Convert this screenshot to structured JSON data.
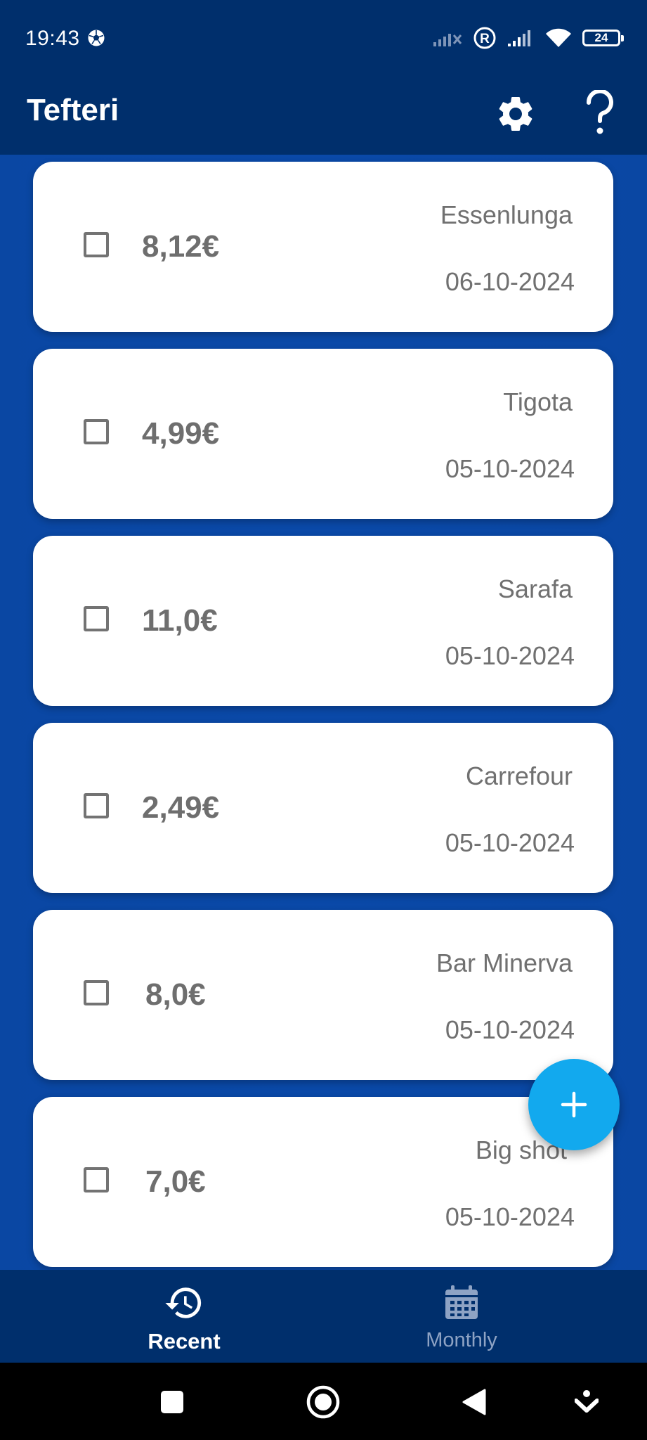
{
  "status_bar": {
    "time": "19:43",
    "battery_level": "24",
    "icons": [
      "soccer-ball-icon",
      "no-signal-icon",
      "roaming-icon",
      "signal-icon",
      "wifi-icon",
      "battery-icon"
    ]
  },
  "app_bar": {
    "title": "Tefteri",
    "actions": [
      "gear-icon",
      "help-icon"
    ]
  },
  "expenses": [
    {
      "amount": "8,12€",
      "merchant": "Essenlunga",
      "date": "06-10-2024",
      "checked": false
    },
    {
      "amount": "4,99€",
      "merchant": "Tigota",
      "date": "05-10-2024",
      "checked": false
    },
    {
      "amount": "11,0€",
      "merchant": "Sarafa",
      "date": "05-10-2024",
      "checked": false
    },
    {
      "amount": "2,49€",
      "merchant": "Carrefour",
      "date": "05-10-2024",
      "checked": false
    },
    {
      "amount": "8,0€",
      "merchant": "Bar Minerva",
      "date": "05-10-2024",
      "checked": false
    },
    {
      "amount": "7,0€",
      "merchant": "Big shot",
      "date": "05-10-2024",
      "checked": false
    }
  ],
  "fab": {
    "icon": "plus-icon"
  },
  "bottom_nav": {
    "items": [
      {
        "label": "Recent",
        "icon": "history-icon",
        "active": true
      },
      {
        "label": "Monthly",
        "icon": "calendar-icon",
        "active": false
      }
    ]
  },
  "colors": {
    "app_bar": "#002f6c",
    "background": "#0a47a3",
    "fab": "#12a9ee",
    "card": "#ffffff",
    "text_gray": "#707070"
  }
}
